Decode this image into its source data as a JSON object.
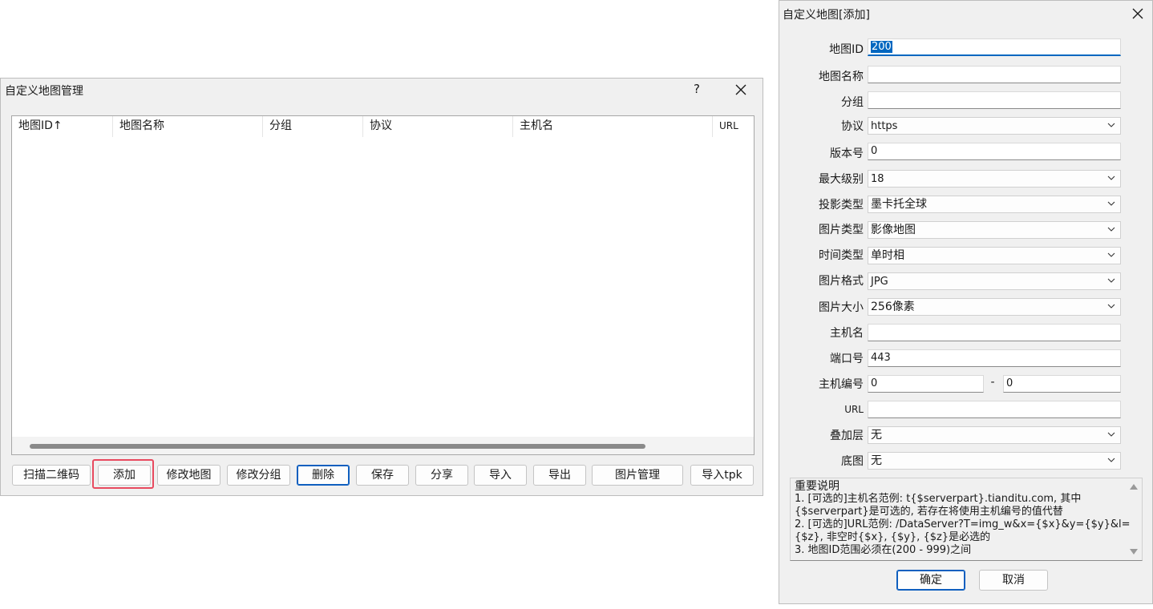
{
  "manager": {
    "title": "自定义地图管理",
    "help": "?",
    "columns": [
      "地图ID↑",
      "地图名称",
      "分组",
      "协议",
      "主机名",
      "URL"
    ],
    "buttons": {
      "scan_qr": "扫描二维码",
      "add": "添加",
      "edit_map": "修改地图",
      "edit_group": "修改分组",
      "delete": "删除",
      "save": "保存",
      "share": "分享",
      "import": "导入",
      "export": "导出",
      "image_manage": "图片管理",
      "import_tpk": "导入tpk"
    }
  },
  "dialog": {
    "title": "自定义地图[添加]",
    "fields": {
      "map_id": {
        "label": "地图ID",
        "value": "200"
      },
      "map_name": {
        "label": "地图名称",
        "value": ""
      },
      "group": {
        "label": "分组",
        "value": ""
      },
      "protocol": {
        "label": "协议",
        "value": "https"
      },
      "version": {
        "label": "版本号",
        "value": "0"
      },
      "max_level": {
        "label": "最大级别",
        "value": "18"
      },
      "projection": {
        "label": "投影类型",
        "value": "墨卡托全球"
      },
      "image_type": {
        "label": "图片类型",
        "value": "影像地图"
      },
      "time_type": {
        "label": "时间类型",
        "value": "单时相"
      },
      "image_format": {
        "label": "图片格式",
        "value": "JPG"
      },
      "image_size": {
        "label": "图片大小",
        "value": "256像素"
      },
      "host": {
        "label": "主机名",
        "value": ""
      },
      "port": {
        "label": "端口号",
        "value": "443"
      },
      "host_num": {
        "label": "主机编号",
        "from": "0",
        "sep": "-",
        "to": "0"
      },
      "url": {
        "label": "URL",
        "value": ""
      },
      "overlay": {
        "label": "叠加层",
        "value": "无"
      },
      "base": {
        "label": "底图",
        "value": "无"
      }
    },
    "notes": [
      "重要说明",
      "1. [可选的]主机名范例: t{$serverpart}.tianditu.com, 其中",
      "{$serverpart}是可选的, 若存在将使用主机编号的值代替",
      "2. [可选的]URL范例: /DataServer?T=img_w&x={$x}&y={$y}&l=",
      "{$z}, 非空时{$x}, {$y}, {$z}是必选的",
      "3. 地图ID范围必须在(200 - 999)之间"
    ],
    "ok": "确定",
    "cancel": "取消"
  }
}
